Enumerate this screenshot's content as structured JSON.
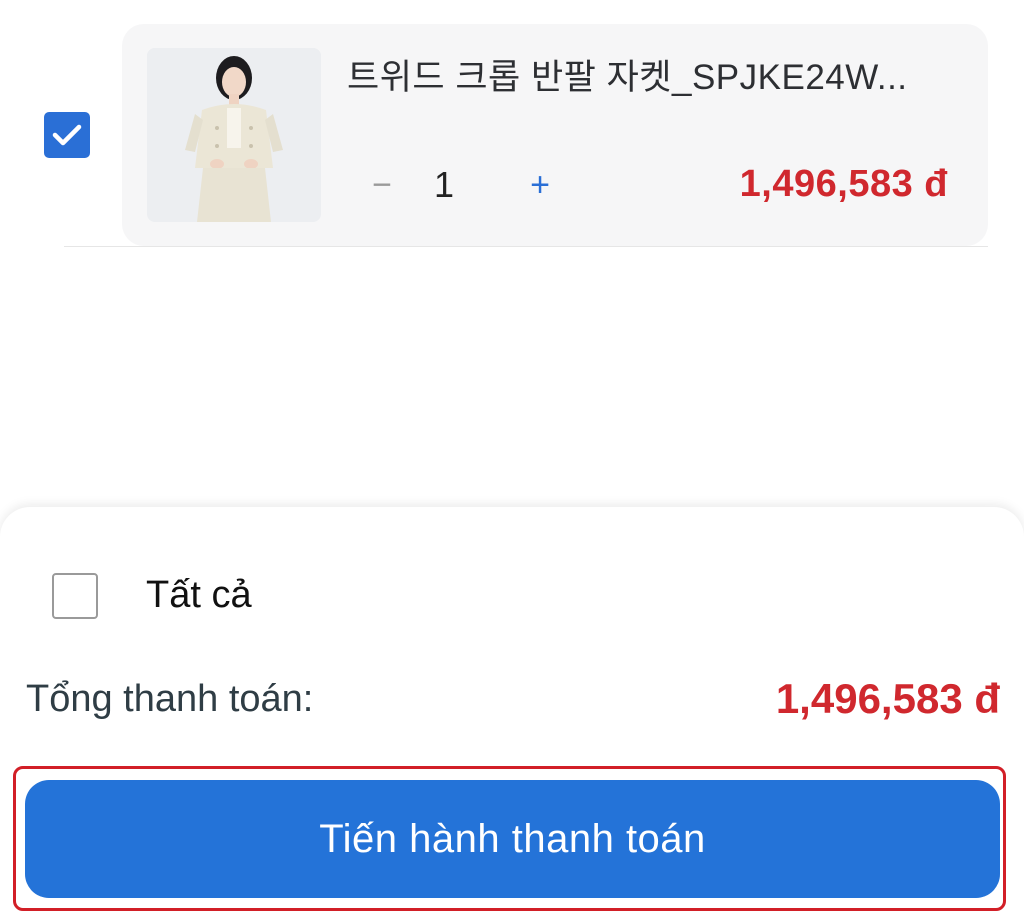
{
  "cart_item": {
    "selected": true,
    "name": "트위드 크롭 반팔 자켓_SPJKE24W...",
    "quantity": "1",
    "minus_symbol": "−",
    "plus_symbol": "+",
    "price": "1,496,583 đ",
    "image_icon": "product-thumbnail"
  },
  "footer": {
    "select_all_label": "Tất cả",
    "select_all_checked": false,
    "total_label": "Tổng thanh toán:",
    "total_value": "1,496,583 đ",
    "checkout_label": "Tiến hành thanh toán"
  },
  "colors": {
    "accent_blue": "#2473d8",
    "price_red": "#d0282e",
    "highlight_red": "#d21f27"
  }
}
